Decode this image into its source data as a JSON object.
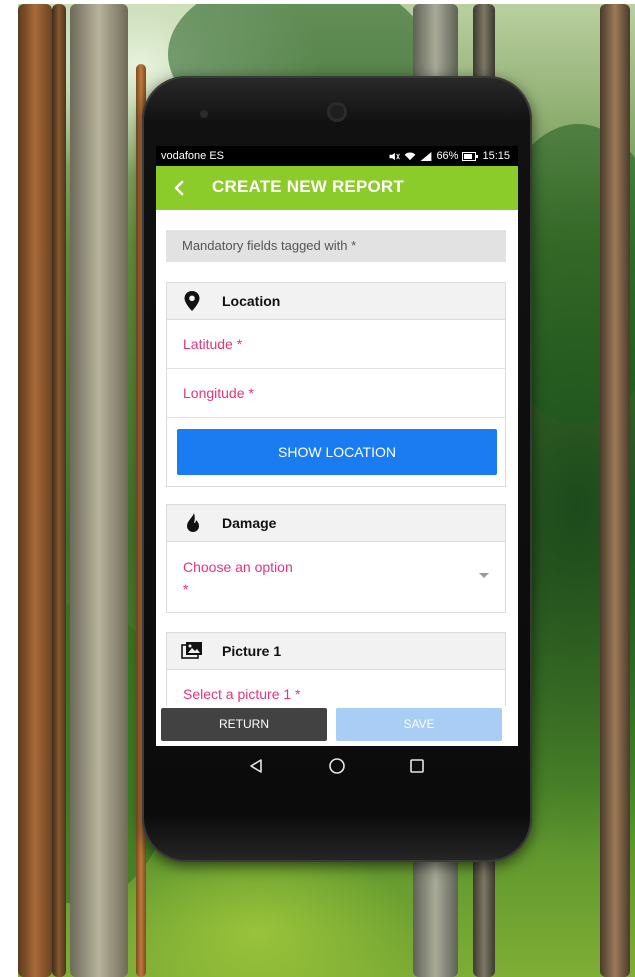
{
  "status_bar": {
    "carrier": "vodafone ES",
    "battery": "66%",
    "time": "15:15",
    "icons": [
      "mute-icon",
      "wifi-icon",
      "signal-icon",
      "battery-icon"
    ]
  },
  "appbar": {
    "title": "CREATE NEW REPORT",
    "back_icon": "chevron-left-icon",
    "color": "#8ccc2a"
  },
  "notice": "Mandatory fields tagged with *",
  "location_section": {
    "title": "Location",
    "icon": "map-pin-icon",
    "latitude_label": "Latitude *",
    "longitude_label": "Longitude *",
    "show_location_button": "SHOW LOCATION"
  },
  "damage_section": {
    "title": "Damage",
    "icon": "drop-icon",
    "select_placeholder": "Choose an option *"
  },
  "picture_section": {
    "title": "Picture 1",
    "icon": "pictures-icon",
    "select_label": "Select a picture 1 *"
  },
  "bottom_buttons": {
    "return_label": "RETURN",
    "save_label": "SAVE"
  },
  "nav_icons": [
    "back-triangle-icon",
    "home-circle-icon",
    "recents-square-icon"
  ],
  "colors": {
    "accent_green": "#8ccc2a",
    "button_blue": "#1a7cf0",
    "required_pink": "#e8337a",
    "return_dark": "#424242",
    "save_disabled": "#a9cdf5"
  }
}
